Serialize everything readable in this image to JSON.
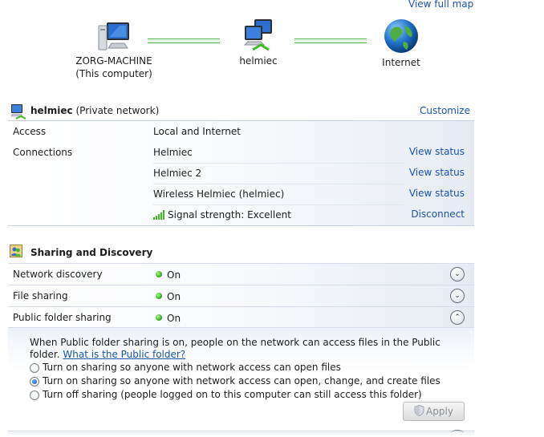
{
  "map": {
    "view_full_map": "View full map",
    "nodes": [
      {
        "name": "ZORG-MACHINE",
        "sub": "(This computer)"
      },
      {
        "name": "helmiec"
      },
      {
        "name": "Internet"
      }
    ]
  },
  "network": {
    "name": "helmiec",
    "type": "(Private network)",
    "customize": "Customize",
    "access_label": "Access",
    "access_value": "Local and Internet",
    "connections_label": "Connections",
    "connections": [
      {
        "name": "Helmiec",
        "action": "View status"
      },
      {
        "name": "Helmiec 2",
        "action": "View status"
      },
      {
        "name": "Wireless Helmiec (helmiec)",
        "action": "View status"
      }
    ],
    "signal_label": "Signal strength:",
    "signal_value": "Excellent",
    "disconnect": "Disconnect"
  },
  "sharing": {
    "title": "Sharing and Discovery",
    "rows": [
      {
        "label": "Network discovery",
        "value": "On"
      },
      {
        "label": "File sharing",
        "value": "On"
      },
      {
        "label": "Public folder sharing",
        "value": "On"
      }
    ],
    "description": "When Public folder sharing is on, people on the network can access files in the Public folder.",
    "what_is_link_a": "What is",
    "what_is_link_b": "the Public folder?",
    "options": [
      {
        "label": "Turn on sharing so anyone with network access can open files",
        "selected": false
      },
      {
        "label": "Turn on sharing so anyone with network access can open, change, and create files",
        "selected": true
      },
      {
        "label": "Turn off sharing (people logged on to this computer can still access this folder)",
        "selected": false
      }
    ],
    "apply": "Apply"
  },
  "colors": {
    "link": "#1a55a6",
    "status_green": "#3dbb25"
  }
}
